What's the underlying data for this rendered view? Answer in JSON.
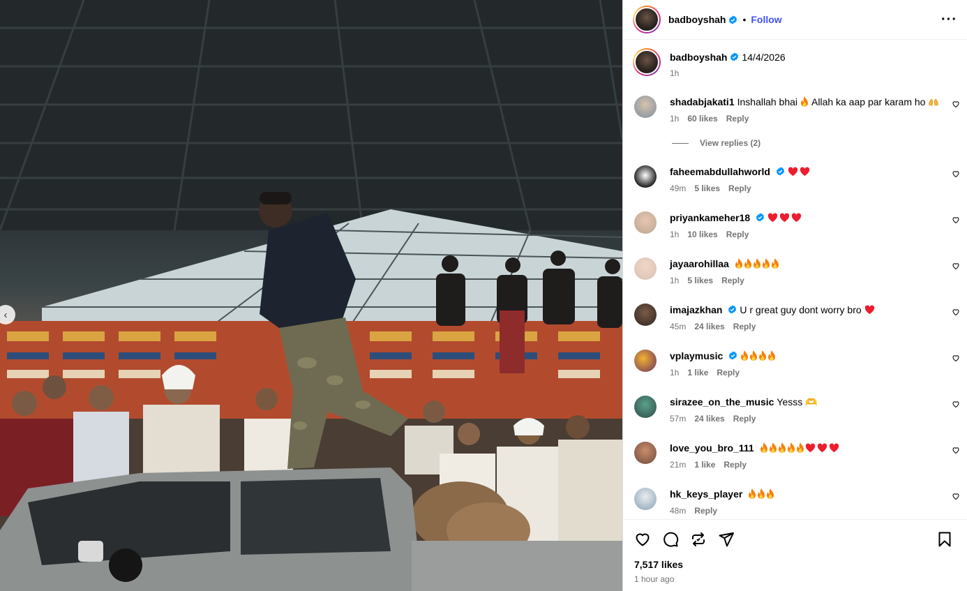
{
  "post": {
    "username": "badboyshah",
    "follow_label": "Follow",
    "more_label": "···",
    "caption_date": "14/4/2026",
    "caption_time": "1h"
  },
  "comments": [
    {
      "user": "shadabjakati1",
      "verified": false,
      "text": "Inshallah bhai",
      "text2": "Allah ka aap par karam ho",
      "time": "1h",
      "likes": "60 likes",
      "reply": "Reply",
      "view_replies": "View replies (2)"
    },
    {
      "user": "faheemabdullahworld",
      "verified": true,
      "text": "",
      "time": "49m",
      "likes": "5 likes",
      "reply": "Reply"
    },
    {
      "user": "priyankameher18",
      "verified": true,
      "text": "",
      "time": "1h",
      "likes": "10 likes",
      "reply": "Reply"
    },
    {
      "user": "jayaarohillaa",
      "verified": false,
      "text": "",
      "time": "1h",
      "likes": "5 likes",
      "reply": "Reply"
    },
    {
      "user": "imajazkhan",
      "verified": true,
      "text": "U r great guy dont worry bro",
      "time": "45m",
      "likes": "24 likes",
      "reply": "Reply"
    },
    {
      "user": "vplaymusic",
      "verified": true,
      "text": "",
      "time": "1h",
      "likes": "1 like",
      "reply": "Reply"
    },
    {
      "user": "sirazee_on_the_music",
      "verified": false,
      "text": "Yesss 🫶",
      "time": "57m",
      "likes": "24 likes",
      "reply": "Reply"
    },
    {
      "user": "love_you_bro_111",
      "verified": false,
      "text": "",
      "time": "21m",
      "likes": "1 like",
      "reply": "Reply"
    },
    {
      "user": "hk_keys_player",
      "verified": false,
      "text": "",
      "time": "48m",
      "likes": "",
      "reply": "Reply"
    }
  ],
  "footer": {
    "likes": "7,517 likes",
    "posted": "1 hour ago"
  },
  "icons": {
    "like": "heart-outline-icon",
    "comment": "speech-bubble-icon",
    "repost": "repost-icon",
    "share": "paper-plane-icon",
    "save": "bookmark-icon",
    "verified": "verified-badge-icon"
  },
  "colors": {
    "follow": "#4150f7",
    "verified": "#0095f6",
    "muted": "#737373"
  }
}
